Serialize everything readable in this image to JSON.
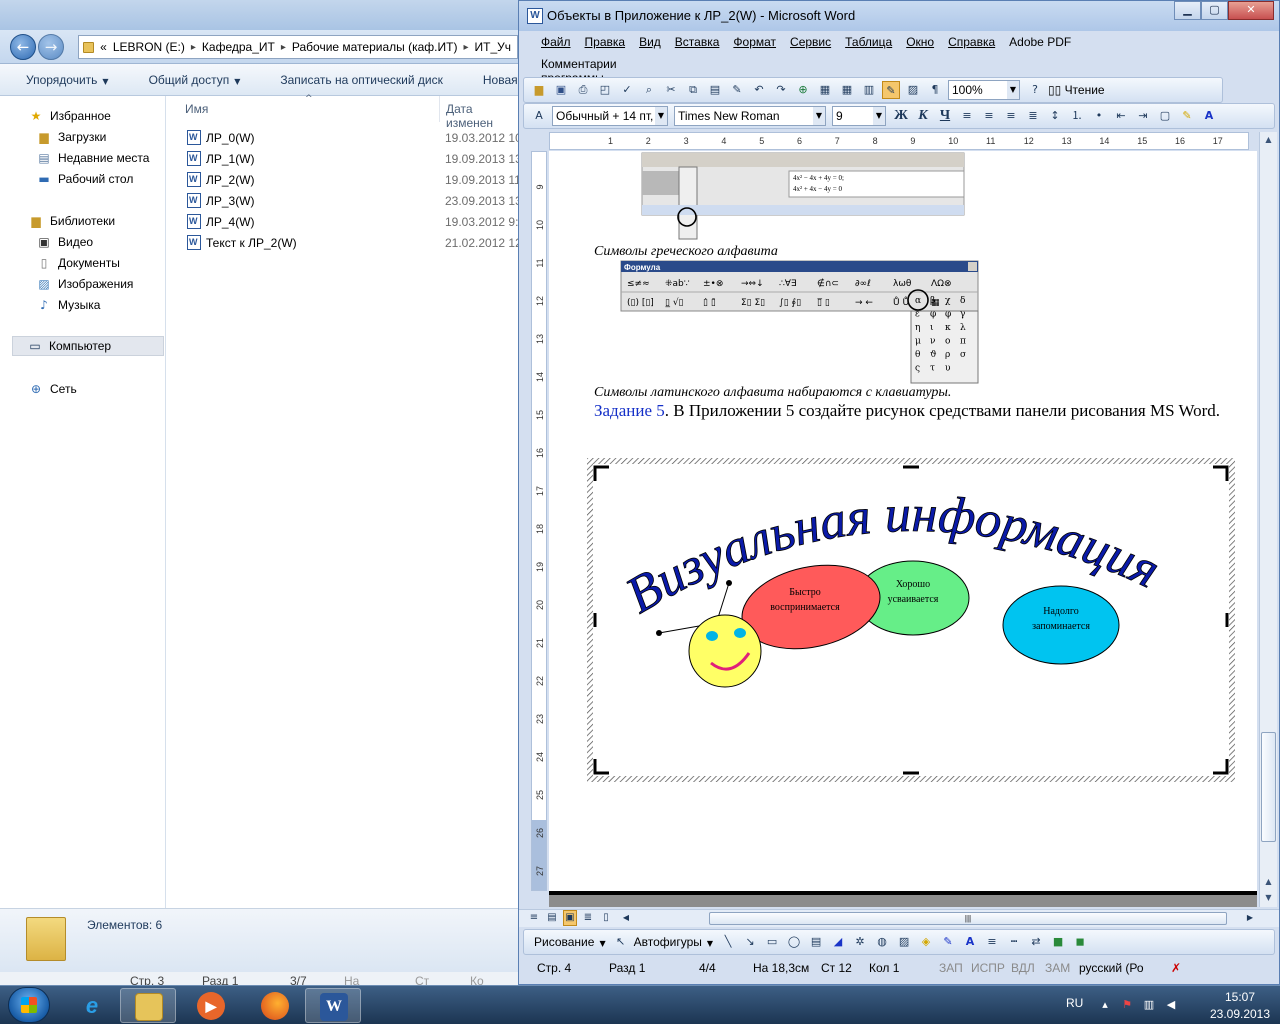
{
  "explorer": {
    "nav": {
      "back_glyph": "←",
      "forward_glyph": "→",
      "address_prefix": "«",
      "address_parts": [
        "LEBRON (E:)",
        "Кафедра_ИТ",
        "Рабочие материалы (каф.ИТ)",
        "ИТ_Уч"
      ]
    },
    "toolbar": {
      "organize": "Упорядочить",
      "share": "Общий доступ",
      "burn": "Записать на оптический диск",
      "new_folder": "Новая папка"
    },
    "nav_pane": {
      "favorites": "Избранное",
      "downloads": "Загрузки",
      "recent": "Недавние места",
      "desktop": "Рабочий стол",
      "libraries": "Библиотеки",
      "video": "Видео",
      "documents": "Документы",
      "images": "Изображения",
      "music": "Музыка",
      "computer": "Компьютер",
      "network": "Сеть"
    },
    "columns": {
      "name": "Имя",
      "date": "Дата изменен"
    },
    "files": [
      {
        "name": "ЛР_0(W)",
        "date": "19.03.2012 10:"
      },
      {
        "name": "ЛР_1(W)",
        "date": "19.09.2013 13:"
      },
      {
        "name": "ЛР_2(W)",
        "date": "19.09.2013 11:"
      },
      {
        "name": "ЛР_3(W)",
        "date": "23.09.2013 13:"
      },
      {
        "name": "ЛР_4(W)",
        "date": "19.03.2012 9:5"
      },
      {
        "name": "Текст к ЛР_2(W)",
        "date": "21.02.2012 12:"
      }
    ],
    "status": {
      "count": "Элементов: 6"
    },
    "bottom_strip": [
      "Стр. 3",
      "Разд 1",
      "3/7",
      "На",
      "Ст",
      "Ко"
    ]
  },
  "word": {
    "title": "Объекты в Приложение к ЛР_2(W) - Microsoft Word",
    "menu": [
      "Файл",
      "Правка",
      "Вид",
      "Вставка",
      "Формат",
      "Сервис",
      "Таблица",
      "Окно",
      "Справка",
      "Adobe PDF"
    ],
    "menu2": "Комментарии программы Acrobat",
    "toolbar_std": {
      "zoom": "100%",
      "reading": "Чтение"
    },
    "toolbar_fmt": {
      "style": "Обычный + 14 пт,",
      "font": "Times New Roman",
      "size": "9"
    },
    "ruler_h": [
      "1",
      "2",
      "3",
      "4",
      "5",
      "6",
      "7",
      "8",
      "9",
      "10",
      "11",
      "12",
      "13",
      "14",
      "15",
      "16",
      "17"
    ],
    "ruler_v": [
      "9",
      "10",
      "11",
      "12",
      "13",
      "14",
      "15",
      "16",
      "17",
      "18",
      "19",
      "20",
      "21",
      "22",
      "23",
      "24",
      "25",
      "26",
      "27"
    ],
    "doc": {
      "caption_greek": "Символы греческого алфавита",
      "formula_title": "Формула",
      "caption_latin": "Символы латинского алфавита набираются с клавиатуры.",
      "task_label": "Задание 5",
      "task_text": ". В Приложении 5 создайте рисунок средствами панели рисования MS Word.",
      "eq1": "4x² − 4x + 4y = 0;",
      "eq2": "4x² + 4x − 4y = 0",
      "wordart": "Визуальная информация",
      "bubbles": [
        {
          "line1": "Быстро",
          "line2": "воспринимается"
        },
        {
          "line1": "Хорошо",
          "line2": "усваивается"
        },
        {
          "line1": "Надолго",
          "line2": "запоминается"
        }
      ],
      "greek_palette": [
        "α",
        "β",
        "χ",
        "δ",
        "ε",
        "φ",
        "φ",
        "γ",
        "η",
        "ι",
        "κ",
        "λ",
        "μ",
        "ν",
        "ο",
        "π",
        "θ",
        "ϑ",
        "ρ",
        "σ",
        "ς",
        "τ",
        "υ"
      ],
      "row1_symbols": [
        "≤≠≈",
        "⁜ab∵",
        "±•⊗",
        "→⇔↓",
        "∴∀∃",
        "∉∩⊂",
        "∂∞ℓ",
        "λωθ",
        "ΛΩ⊗"
      ],
      "row2_symbols": [
        "(▯) [▯]",
        "▯̲ √▯",
        "▯̇ ▯̄",
        "Σ▯ Σ▯",
        "∫▯ ∮▯",
        "▯̅ ▯",
        "→ ←",
        "Ů Ů",
        "▦"
      ]
    },
    "draw_toolbar": {
      "drawing": "Рисование",
      "autoshapes": "Автофигуры"
    },
    "status": {
      "page": "Стр. 4",
      "section": "Разд 1",
      "pages": "4/4",
      "at": "На 18,3см",
      "line": "Ст 12",
      "col": "Кол 1",
      "rec": "ЗАП",
      "trk": "ИСПР",
      "ext": "ВДЛ",
      "ovr": "ЗАМ",
      "lang": "русский (Ро"
    },
    "colors": {
      "bubble1": "#ff5a5a",
      "bubble2": "#66ee88",
      "bubble3": "#00c4f0",
      "face": "#ffff66",
      "wordart": "#0a1aa8"
    }
  },
  "taskbar": {
    "lang": "RU",
    "time": "15:07",
    "date": "23.09.2013"
  }
}
